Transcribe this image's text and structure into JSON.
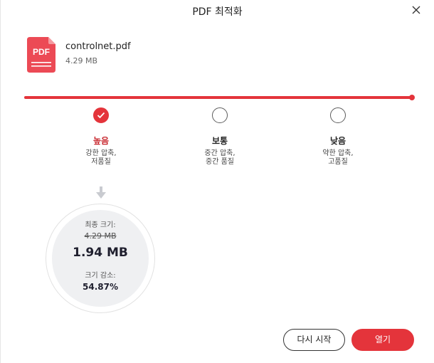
{
  "dialog": {
    "title": "PDF 최적화",
    "close_icon": "close-icon"
  },
  "file": {
    "icon_label": "PDF",
    "name": "controlnet.pdf",
    "size": "4.29 MB"
  },
  "compression": {
    "accent_color": "#e4343b",
    "options": [
      {
        "title": "높음",
        "desc_line1": "강한 압축,",
        "desc_line2": "저품질",
        "selected": true
      },
      {
        "title": "보통",
        "desc_line1": "중간 압축,",
        "desc_line2": "중간 품질",
        "selected": false
      },
      {
        "title": "낮음",
        "desc_line1": "약한 압축,",
        "desc_line2": "고품질",
        "selected": false
      }
    ]
  },
  "result": {
    "final_label": "최종 크기:",
    "original_size": "4.29 MB",
    "final_size": "1.94 MB",
    "reduction_label": "크기 감소:",
    "reduction_value": "54.87%"
  },
  "buttons": {
    "restart": "다시 시작",
    "open": "열기"
  }
}
